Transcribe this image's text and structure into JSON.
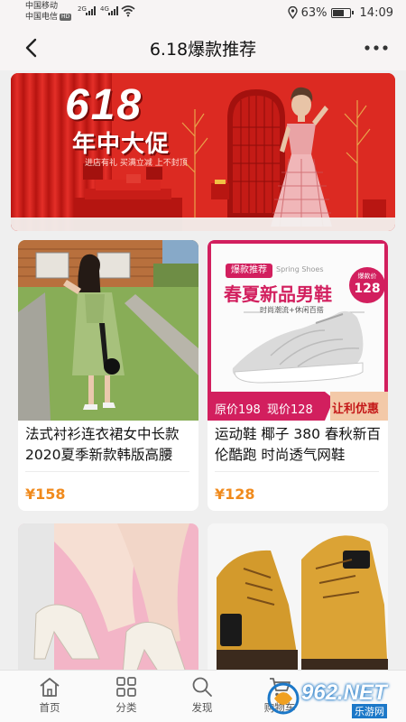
{
  "status_bar": {
    "carrier_1": "中国移动",
    "carrier_2": "中国电信",
    "hd_badge": "HD",
    "network_1": "2G",
    "network_2": "4G",
    "battery_percent": "63%",
    "time": "14:09"
  },
  "header": {
    "title": "6.18爆款推荐"
  },
  "banner": {
    "headline": "618",
    "subtitle": "年中大促",
    "note": "进店有礼 买满立减 上不封顶"
  },
  "products": [
    {
      "name": "法式衬衫连衣裙女中长款2020夏季新款韩版高腰",
      "price": "¥158"
    },
    {
      "name": "运动鞋 椰子 380 春秋新百伦酷跑 时尚透气网鞋",
      "price": "¥128",
      "ad": {
        "tag": "爆款推荐",
        "tag_en": "Spring Shoes",
        "headline": "春夏新品男鞋",
        "tagline": "时尚潮流+休闲百搭",
        "badge_label": "爆款价",
        "badge_price": "128",
        "original_price": "原价198",
        "current_price": "现价128",
        "promo": "让利优惠"
      }
    },
    {
      "name": "",
      "price": ""
    },
    {
      "name": "",
      "price": ""
    }
  ],
  "tabbar": {
    "tabs": [
      {
        "label": "首页"
      },
      {
        "label": "分类"
      },
      {
        "label": "发现"
      },
      {
        "label": "购物车"
      }
    ]
  },
  "watermark": {
    "text": "962.NET",
    "sub": "乐游网"
  },
  "colors": {
    "accent": "#f08a1c",
    "banner_red": "#d9201b",
    "ad_pink": "#d21f5e"
  }
}
